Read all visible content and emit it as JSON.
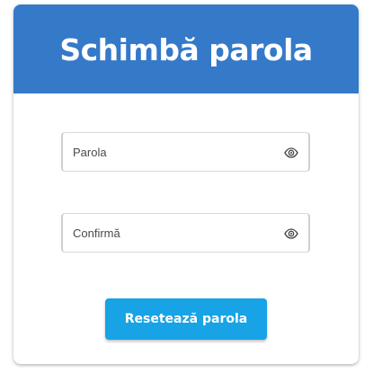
{
  "header": {
    "title": "Schimbă parola"
  },
  "form": {
    "password": {
      "label": "Parola",
      "value": "",
      "icon": "eye-icon"
    },
    "confirm": {
      "label": "Confirmă",
      "value": "",
      "icon": "eye-icon"
    },
    "submit_label": "Resetează parola"
  },
  "colors": {
    "header_bg": "#3579c9",
    "button_bg": "#17a3e6"
  }
}
